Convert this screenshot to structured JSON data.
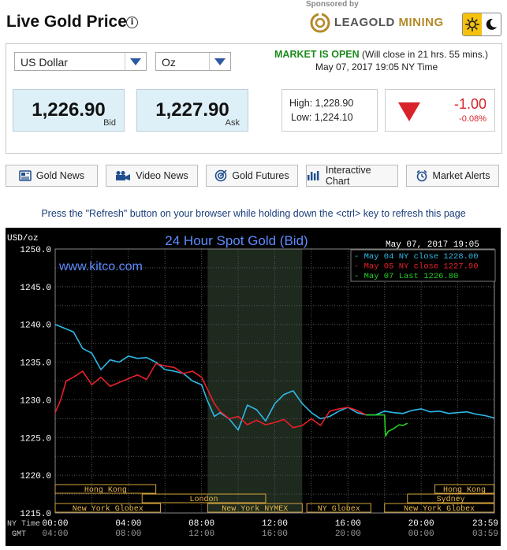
{
  "header": {
    "title": "Live Gold Price",
    "info_icon": "info-icon",
    "sponsored": "Sponsored by",
    "brand_part1": "LEAGOLD",
    "brand_part2": " MINING",
    "theme_icons": [
      "sun-icon",
      "moon-icon"
    ]
  },
  "panel": {
    "currency": "US Dollar",
    "unit": "Oz",
    "market_status": "MARKET IS OPEN",
    "market_note": " (Will close in 21 hrs. 55 mins.)",
    "market_time": "May 07, 2017 19:05 NY Time",
    "bid": "1,226.90",
    "bid_label": "Bid",
    "ask": "1,227.90",
    "ask_label": "Ask",
    "high": "High: 1,228.90",
    "low": "Low: 1,224.10",
    "change": "-1.00",
    "change_pct": "-0.08%",
    "colors": {
      "up": "#1b8a1b",
      "down": "#d9232a",
      "price_bg": "#ddf0f7"
    }
  },
  "nav": [
    {
      "label": "Gold News",
      "icon": "newspaper-icon"
    },
    {
      "label": "Video News",
      "icon": "video-camera-icon"
    },
    {
      "label": "Gold Futures",
      "icon": "target-icon"
    },
    {
      "label": "Interactive Chart",
      "icon": "bar-chart-icon"
    },
    {
      "label": "Market Alerts",
      "icon": "alarm-icon"
    }
  ],
  "refresh_note": "Press the \"Refresh\" button on your browser while holding down the <ctrl> key to refresh this page",
  "chart_data": {
    "type": "line",
    "title": "24 Hour Spot Gold (Bid)",
    "ylabel": "USD/oz",
    "watermark": "www.kitco.com",
    "timestamp": "May 07, 2017 19:05",
    "ylim": [
      1215.0,
      1250.0
    ],
    "y_ticks": [
      "1250.0",
      "1245.0",
      "1240.0",
      "1235.0",
      "1230.0",
      "1225.0",
      "1220.0",
      "1215.0"
    ],
    "x_row1_label": "NY Time",
    "x_row2_label": "GMT",
    "x_ticks_ny": [
      "00:00",
      "04:00",
      "08:00",
      "12:00",
      "16:00",
      "20:00",
      "23:59"
    ],
    "x_ticks_gmt": [
      "04:00",
      "08:00",
      "12:00",
      "16:00",
      "20:00",
      "00:00",
      "03:59"
    ],
    "grid": true,
    "legend_position": "top-right",
    "legend": [
      {
        "text": "May 04 NY close 1228.00",
        "color": "#2fb8e6"
      },
      {
        "text": "May 05 NY close 1227.90",
        "color": "#e8202a"
      },
      {
        "text": "May 07 Last 1226.80",
        "color": "#22d022"
      }
    ],
    "sessions_row1": [
      {
        "name": "Hong Kong",
        "start": 0.0,
        "end": 5.5
      },
      {
        "name": "Hong Kong",
        "start": 20.75,
        "end": 23.98
      }
    ],
    "sessions_row2": [
      {
        "name": "London",
        "start": 4.75,
        "end": 11.5
      },
      {
        "name": "Sydney",
        "start": 19.25,
        "end": 23.98
      }
    ],
    "sessions_row3": [
      {
        "name": "New York Globex",
        "start": 0.0,
        "end": 5.75
      },
      {
        "name": "New York NYMEX",
        "start": 8.33,
        "end": 13.5
      },
      {
        "name": "NY Globex",
        "start": 13.75,
        "end": 17.25
      },
      {
        "name": "New York Globex",
        "start": 18.0,
        "end": 23.98
      }
    ],
    "shaded_region": [
      8.33,
      13.5
    ],
    "series": [
      {
        "name": "May 04 NY close 1228.00",
        "color": "#2fb8e6",
        "x": [
          0,
          0.5,
          1.0,
          1.5,
          2.0,
          2.5,
          3.0,
          3.5,
          4.0,
          4.5,
          5.0,
          5.5,
          6.0,
          6.5,
          7.0,
          7.5,
          8.0,
          8.3,
          8.7,
          9.0,
          9.5,
          10.0,
          10.5,
          11.0,
          11.5,
          12.0,
          12.5,
          13.0,
          13.5,
          14.0,
          14.5,
          15.0,
          15.5,
          16.0,
          16.5,
          17.0,
          17.5,
          18.0,
          18.5,
          19.0,
          19.5,
          20.0,
          20.5,
          21.0,
          21.5,
          22.0,
          22.5,
          23.0,
          23.5,
          23.98
        ],
        "y": [
          1240.0,
          1239.5,
          1239.0,
          1236.8,
          1236.2,
          1234.0,
          1235.3,
          1235.0,
          1235.8,
          1235.5,
          1235.6,
          1235.0,
          1234.0,
          1233.8,
          1233.5,
          1232.5,
          1232.0,
          1230.0,
          1227.8,
          1228.3,
          1227.5,
          1226.0,
          1229.3,
          1228.7,
          1227.2,
          1229.5,
          1230.7,
          1231.2,
          1229.5,
          1228.3,
          1227.5,
          1227.8,
          1228.5,
          1229.0,
          1228.3,
          1228.0,
          1228.0,
          1228.5,
          1228.3,
          1228.2,
          1228.6,
          1228.8,
          1228.4,
          1228.5,
          1228.2,
          1228.3,
          1228.4,
          1228.1,
          1227.9,
          1227.6
        ]
      },
      {
        "name": "May 05 NY close 1227.90",
        "color": "#e8202a",
        "x": [
          0,
          0.3,
          0.6,
          1.0,
          1.5,
          2.0,
          2.5,
          3.0,
          3.5,
          4.0,
          4.5,
          5.0,
          5.5,
          6.0,
          6.5,
          7.0,
          7.5,
          8.0,
          8.3,
          8.7,
          9.0,
          9.5,
          10.0,
          10.5,
          11.0,
          11.5,
          12.0,
          12.5,
          13.0,
          13.5,
          14.0,
          14.5,
          15.0,
          15.5,
          16.0,
          16.5,
          17.0
        ],
        "y": [
          1228.3,
          1230.0,
          1232.5,
          1233.0,
          1233.8,
          1232.0,
          1233.0,
          1231.8,
          1232.3,
          1232.8,
          1233.3,
          1232.7,
          1234.8,
          1234.5,
          1234.3,
          1233.5,
          1233.8,
          1233.0,
          1231.5,
          1229.5,
          1228.5,
          1227.5,
          1227.8,
          1226.7,
          1227.3,
          1226.7,
          1227.0,
          1227.4,
          1226.3,
          1226.6,
          1227.5,
          1226.6,
          1228.5,
          1228.8,
          1229.0,
          1228.6,
          1228.0
        ]
      },
      {
        "name": "May 07 Last 1226.80",
        "color": "#22d022",
        "x": [
          17.0,
          17.5,
          18.0,
          18.05,
          18.2,
          18.5,
          18.8,
          19.0,
          19.25
        ],
        "y": [
          1228.0,
          1228.0,
          1228.0,
          1225.2,
          1225.8,
          1226.2,
          1226.7,
          1226.6,
          1226.9
        ]
      }
    ]
  }
}
